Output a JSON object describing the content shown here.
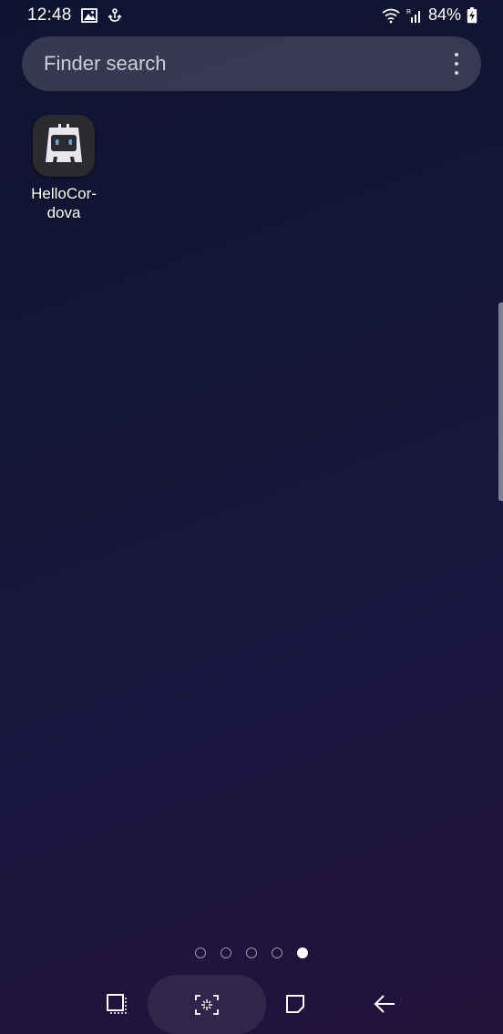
{
  "status_bar": {
    "time": "12:48",
    "left_icons": [
      "image-icon",
      "sync-icon"
    ],
    "right_icons": [
      "wifi-icon",
      "signal-icon",
      "battery-charging-icon"
    ],
    "battery": "84%"
  },
  "search": {
    "placeholder": "Finder search",
    "menu_icon": "more-vertical-icon"
  },
  "apps": [
    {
      "label": "HelloCor-\ndova",
      "icon": "cordova-icon"
    }
  ],
  "pager": {
    "count": 5,
    "active_index": 4
  },
  "nav_bar": {
    "icons": [
      "recents-icon",
      "home-icon",
      "overview-icon",
      "back-icon"
    ]
  },
  "colors": {
    "background_top": "#101330",
    "background_bottom": "#22123a",
    "app_icon_bg": "#2a2b2e",
    "cordova_blue": "#5fa6d8"
  }
}
